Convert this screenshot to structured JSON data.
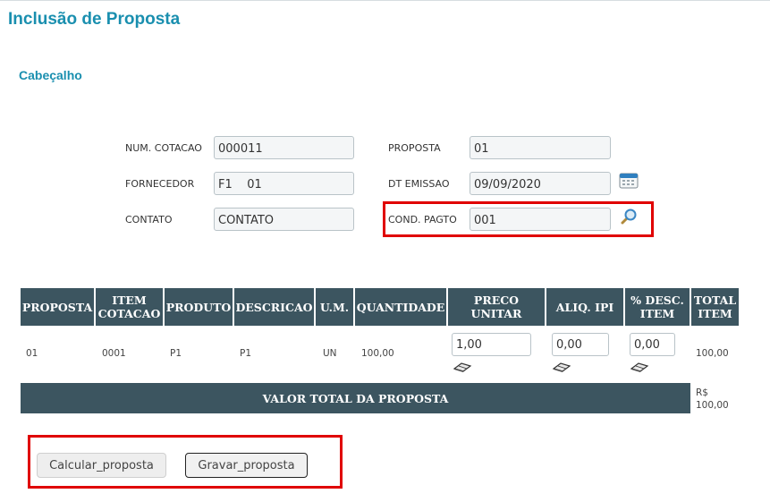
{
  "page_title": "Inclusão de Proposta",
  "section_title": "Cabeçalho",
  "form": {
    "num_cotacao_label": "NUM. COTACAO",
    "num_cotacao_value": "000011",
    "fornecedor_label": "FORNECEDOR",
    "fornecedor_value": "F1    01",
    "contato_label": "CONTATO",
    "contato_value": "CONTATO",
    "proposta_label": "PROPOSTA",
    "proposta_value": "01",
    "dt_emissao_label": "DT EMISSAO",
    "dt_emissao_value": "09/09/2020",
    "cond_pagto_label": "COND. PAGTO",
    "cond_pagto_value": "001"
  },
  "grid": {
    "headers": [
      "PROPOSTA",
      "ITEM COTACAO",
      "PRODUTO",
      "DESCRICAO",
      "U.M.",
      "QUANTIDADE",
      "PRECO UNITAR",
      "ALIQ. IPI",
      "% DESC. ITEM",
      "TOTAL ITEM"
    ],
    "row": {
      "proposta": "01",
      "item_cotacao": "0001",
      "produto": "P1",
      "descricao": "P1",
      "um": "UN",
      "quantidade": "100,00",
      "preco_unitar": "1,00",
      "aliq_ipi": "0,00",
      "desc_item": "0,00",
      "total_item": "100,00"
    },
    "total_label": "VALOR TOTAL DA PROPOSTA",
    "total_currency": "R$",
    "total_value": "100,00"
  },
  "buttons": {
    "calcular": "Calcular_proposta",
    "gravar": "Gravar_proposta"
  },
  "colors": {
    "title": "#1a8faf",
    "grid_header": "#3c5560",
    "highlight": "#e00000"
  }
}
